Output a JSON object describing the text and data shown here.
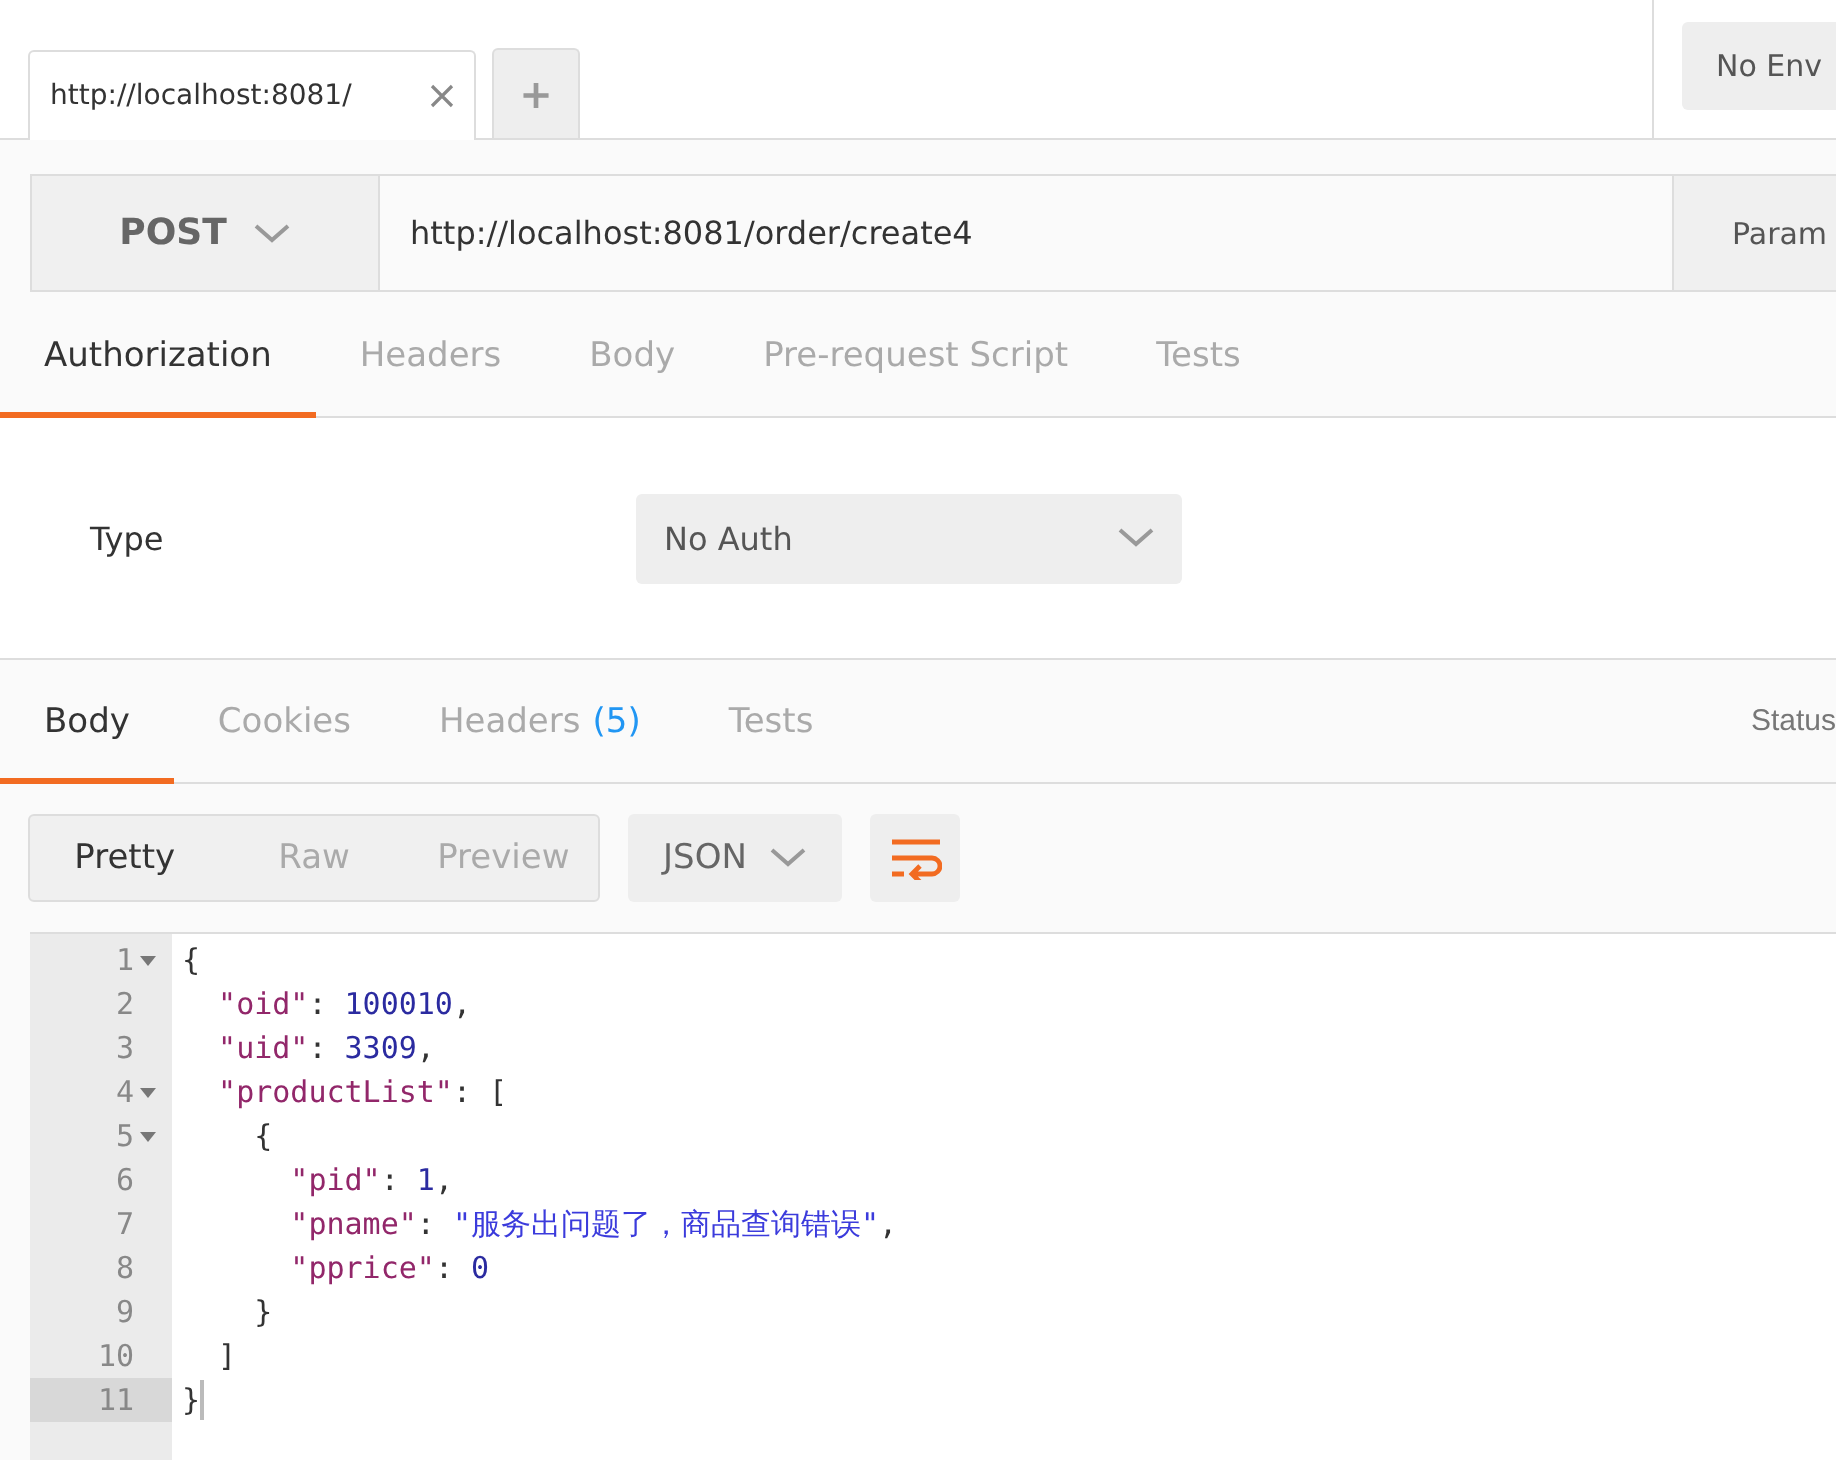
{
  "top_tabs": [
    {
      "label": "http://localhost:8081/",
      "selected": true
    }
  ],
  "new_tab": "+",
  "environment": "No Env",
  "request": {
    "method": "POST",
    "url": "http://localhost:8081/order/create4",
    "params": "Param"
  },
  "request_tabs": [
    {
      "label": "Authorization",
      "selected": true
    },
    {
      "label": "Headers",
      "selected": false
    },
    {
      "label": "Body",
      "selected": false
    },
    {
      "label": "Pre-request Script",
      "selected": false
    },
    {
      "label": "Tests",
      "selected": false
    }
  ],
  "auth": {
    "label": "Type",
    "value": "No Auth"
  },
  "response_tabs": [
    {
      "label": "Body",
      "selected": true
    },
    {
      "label": "Cookies",
      "selected": false
    },
    {
      "label": "Headers",
      "count": "(5)",
      "selected": false
    },
    {
      "label": "Tests",
      "selected": false
    }
  ],
  "status": "Status",
  "view_modes": [
    {
      "label": "Pretty",
      "selected": true
    },
    {
      "label": "Raw",
      "selected": false
    },
    {
      "label": "Preview",
      "selected": false
    }
  ],
  "format": "JSON",
  "code_lines": [
    {
      "number": "1",
      "foldable": true,
      "active": false,
      "tokens": [
        {
          "kind": "punct",
          "text": "{"
        }
      ]
    },
    {
      "number": "2",
      "foldable": false,
      "active": false,
      "tokens": [
        {
          "kind": "key",
          "text": "  \"oid\""
        },
        {
          "kind": "punct",
          "text": ": "
        },
        {
          "kind": "number",
          "text": "100010"
        },
        {
          "kind": "punct",
          "text": ","
        }
      ]
    },
    {
      "number": "3",
      "foldable": false,
      "active": false,
      "tokens": [
        {
          "kind": "key",
          "text": "  \"uid\""
        },
        {
          "kind": "punct",
          "text": ": "
        },
        {
          "kind": "number",
          "text": "3309"
        },
        {
          "kind": "punct",
          "text": ","
        }
      ]
    },
    {
      "number": "4",
      "foldable": true,
      "active": false,
      "tokens": [
        {
          "kind": "key",
          "text": "  \"productList\""
        },
        {
          "kind": "punct",
          "text": ": ["
        }
      ]
    },
    {
      "number": "5",
      "foldable": true,
      "active": false,
      "tokens": [
        {
          "kind": "punct",
          "text": "    {"
        }
      ]
    },
    {
      "number": "6",
      "foldable": false,
      "active": false,
      "tokens": [
        {
          "kind": "key",
          "text": "      \"pid\""
        },
        {
          "kind": "punct",
          "text": ": "
        },
        {
          "kind": "number",
          "text": "1"
        },
        {
          "kind": "punct",
          "text": ","
        }
      ]
    },
    {
      "number": "7",
      "foldable": false,
      "active": false,
      "tokens": [
        {
          "kind": "key",
          "text": "      \"pname\""
        },
        {
          "kind": "punct",
          "text": ": "
        },
        {
          "kind": "string",
          "text": "\"服务出问题了，商品查询错误\""
        },
        {
          "kind": "punct",
          "text": ","
        }
      ]
    },
    {
      "number": "8",
      "foldable": false,
      "active": false,
      "tokens": [
        {
          "kind": "key",
          "text": "      \"pprice\""
        },
        {
          "kind": "punct",
          "text": ": "
        },
        {
          "kind": "number",
          "text": "0"
        }
      ]
    },
    {
      "number": "9",
      "foldable": false,
      "active": false,
      "tokens": [
        {
          "kind": "punct",
          "text": "    }"
        }
      ]
    },
    {
      "number": "10",
      "foldable": false,
      "active": false,
      "tokens": [
        {
          "kind": "punct",
          "text": "  ]"
        }
      ]
    },
    {
      "number": "11",
      "foldable": false,
      "active": true,
      "tokens": [
        {
          "kind": "punct",
          "text": "}"
        }
      ]
    }
  ]
}
